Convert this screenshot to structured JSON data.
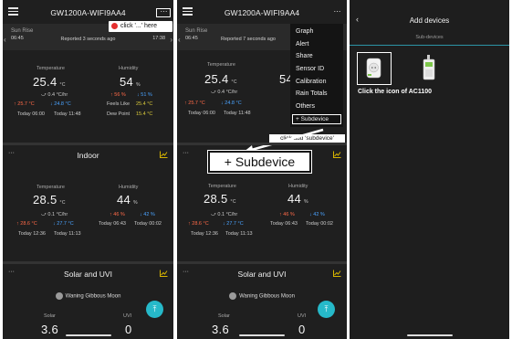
{
  "device": {
    "title": "GW1200A-WIFI9AA4",
    "more_icon": "⋯"
  },
  "sun": {
    "rise_label": "Sun Rise",
    "rise_time": "06:45",
    "set_label": "Sun Set",
    "set_time": "17:38",
    "reported_1": "Reported 3 seconds ago",
    "reported_2": "Reported 7 seconds ago"
  },
  "outdoor": {
    "temp_label": "Temperature",
    "temp_value": "25.4",
    "temp_unit": "°C",
    "temp_trend": "⤻ 0.4 °C/hr",
    "temp_high": "↑ 25.7 °C",
    "temp_low": "↓ 24.8 °C",
    "temp_high_time": "Today 06:00",
    "temp_low_time": "Today 11:48",
    "hum_label": "Humidity",
    "hum_value": "54",
    "hum_unit": "%",
    "hum_high": "↑ 56 %",
    "hum_low": "↓ 51 %",
    "feels_label": "Feels Like",
    "feels_value": "25.4 °C",
    "dew_label": "Dew Point",
    "dew_value": "15.4 °C"
  },
  "indoor": {
    "title": "Indoor",
    "temp_label": "Temperature",
    "temp_value": "28.5",
    "temp_unit": "°C",
    "temp_trend": "⤻ 0.1 °C/hr",
    "temp_high": "↑ 28.6 °C",
    "temp_low": "↓ 27.7 °C",
    "temp_high_time": "Today 12:36",
    "temp_low_time": "Today 11:13",
    "hum_label": "Humidity",
    "hum_value": "44",
    "hum_unit": "%",
    "hum_high": "↑ 46 %",
    "hum_low": "↓ 42 %",
    "hum_high_time": "Today 06:43",
    "hum_low_time": "Today 00:02"
  },
  "solar": {
    "title": "Solar and UVI",
    "moon": "Waning Gibbous Moon",
    "solar_label": "Solar",
    "solar_value": "3.6",
    "uvi_label": "UVI",
    "uvi_value": "0"
  },
  "callouts": {
    "click_here": "click '...' here",
    "click_add": "click add 'subdevice'",
    "big_subdevice": "+ Subdevice"
  },
  "menu": {
    "items": [
      "Graph",
      "Alert",
      "Share",
      "Sensor ID",
      "Calibration",
      "Rain Totals",
      "Others"
    ],
    "subdevice": "+ Subdevice"
  },
  "add_devices": {
    "title": "Add devices",
    "tab": "Sub-devices",
    "hint": "Click the icon of AC1100"
  },
  "colors": {
    "high": "#ff6a48",
    "low": "#4aa3ff",
    "accent": "#26b9c9",
    "chart_icon": "#d6b400"
  }
}
